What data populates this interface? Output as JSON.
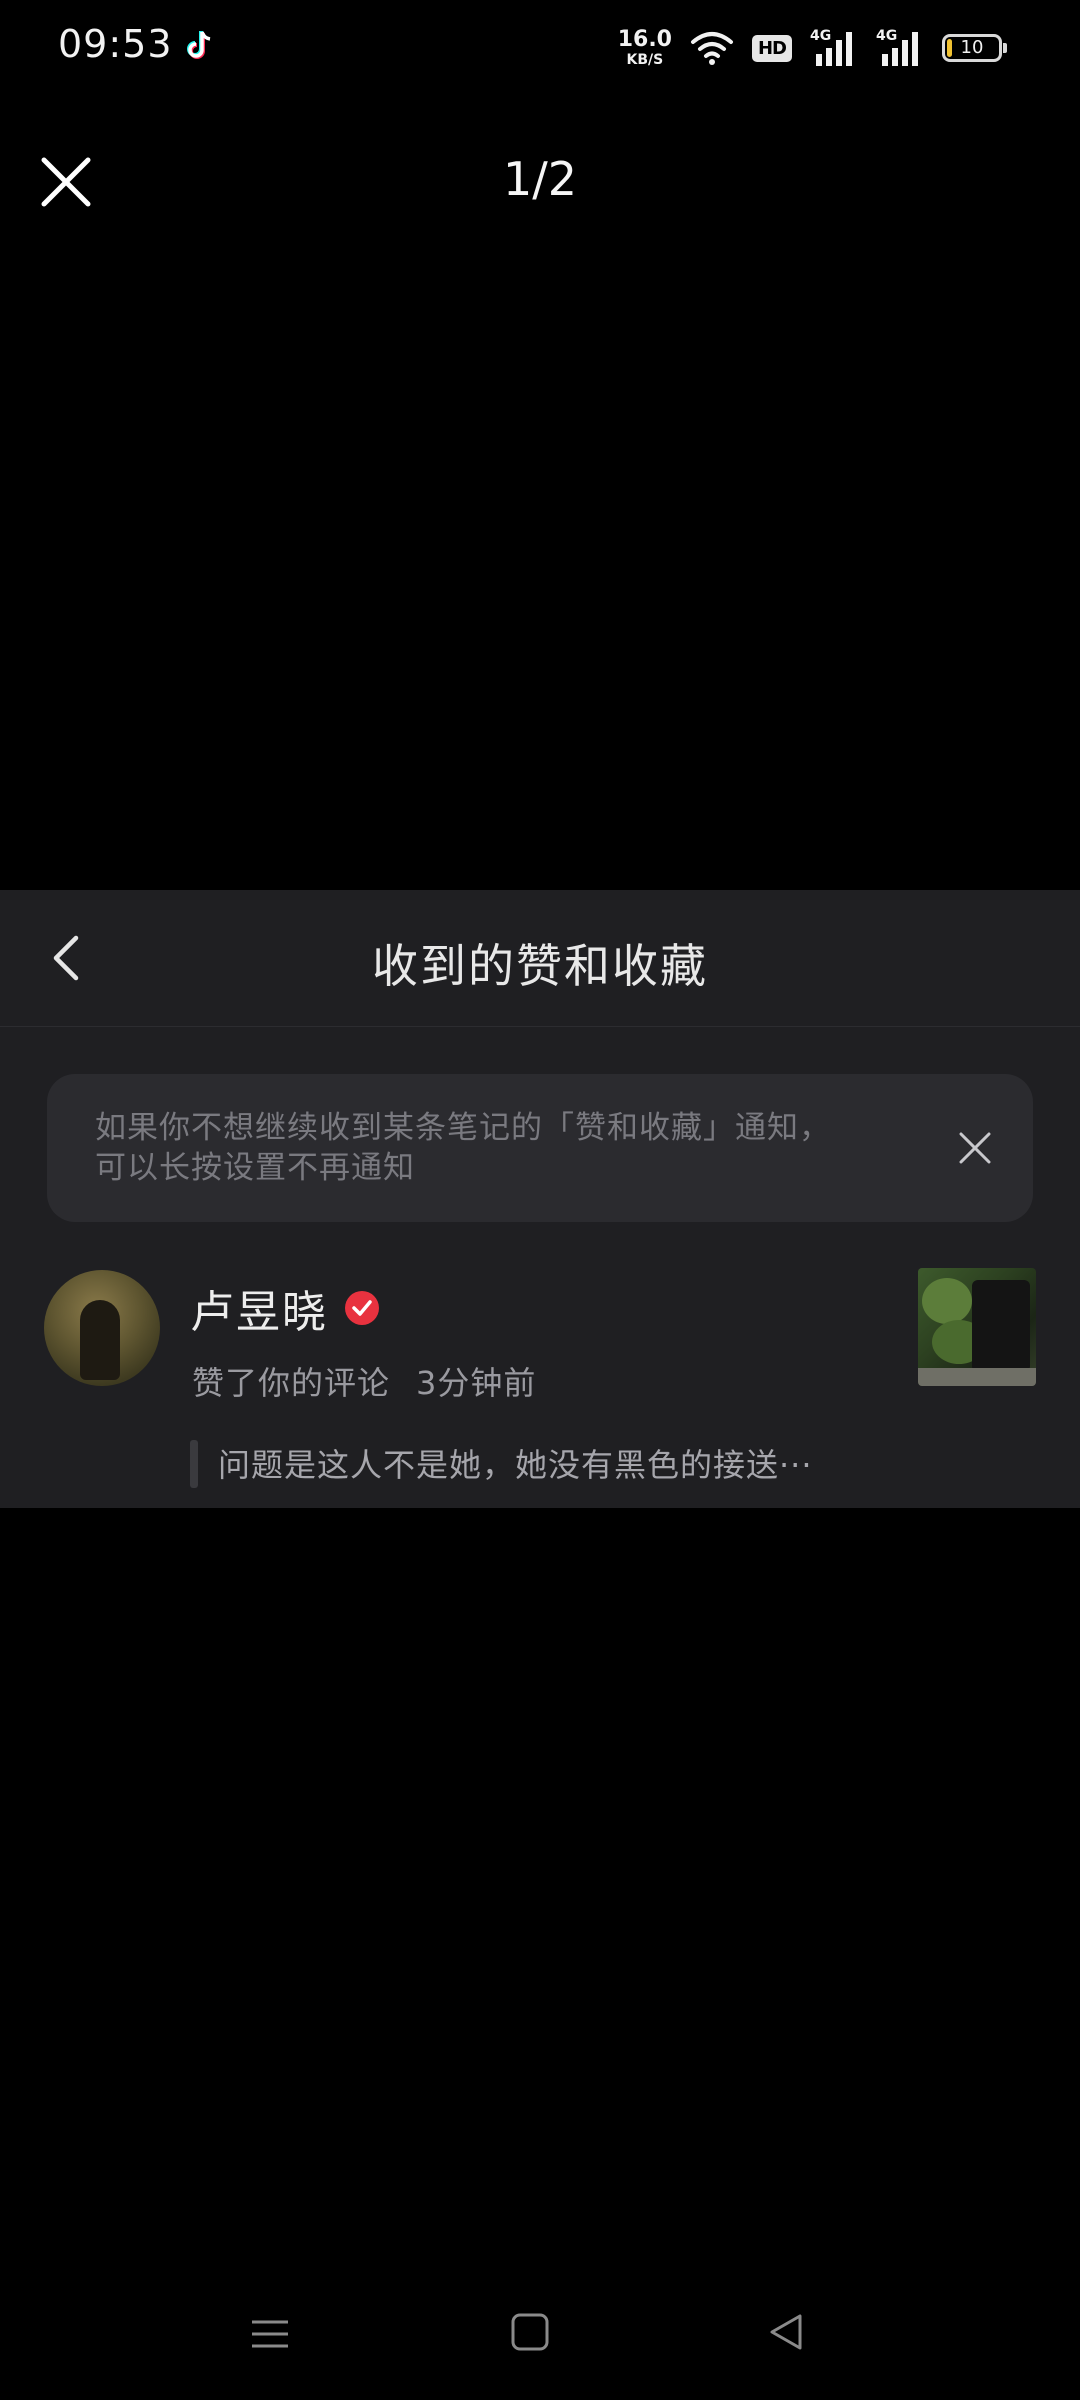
{
  "status_bar": {
    "time": "09:53",
    "app_icon": "tiktok-icon",
    "net_speed_value": "16.0",
    "net_speed_unit": "KB/S",
    "hd_label": "HD",
    "signal_1_label": "4G",
    "signal_2_label": "4G",
    "battery_level": "10",
    "battery_fraction": 0.1,
    "battery_color": "#f1c232"
  },
  "viewer": {
    "close_icon": "close-icon",
    "page_indicator": "1/2"
  },
  "panel": {
    "back_icon": "chevron-left-icon",
    "title": "收到的赞和收藏",
    "tip": {
      "line1": "如果你不想继续收到某条笔记的「赞和收藏」通知，",
      "line2": "可以长按设置不再通知",
      "close_icon": "close-icon"
    },
    "notifications": [
      {
        "user_name": "卢昱晓",
        "verified_icon": "verified-check-icon",
        "action": "赞了你的评论",
        "time_ago": "3分钟前",
        "quoted_comment": "问题是这人不是她，她没有黑色的接送···"
      }
    ],
    "verified_color": "#e8323f"
  },
  "nav_bar": {
    "menu_icon": "menu-icon",
    "home_icon": "home-square-icon",
    "back_icon": "back-triangle-icon"
  }
}
